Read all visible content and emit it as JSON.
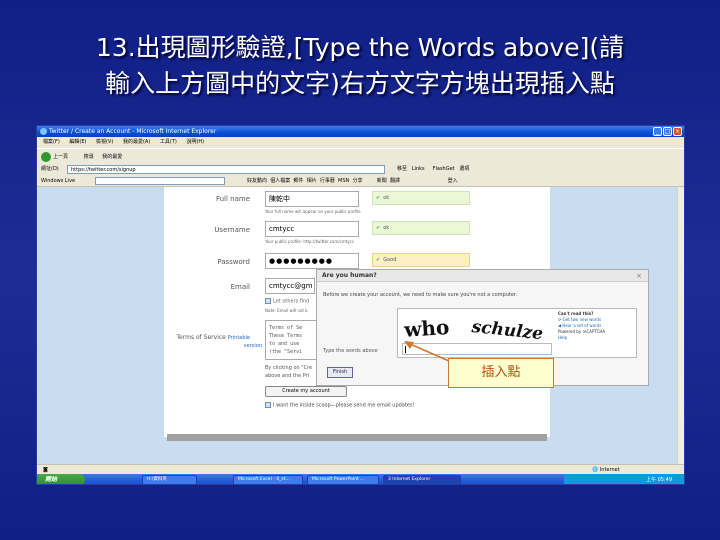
{
  "slide": {
    "title_line1": "13.出現圖形驗證,[Type the Words above](請",
    "title_line2": "輸入上方圖中的文字)右方文字方塊出現插入點"
  },
  "browser": {
    "title": "Twitter / Create an Account - Microsoft Internet Explorer",
    "menu": [
      "檔案(F)",
      "編輯(E)",
      "檢視(V)",
      "我的最愛(A)",
      "工具(T)",
      "說明(H)"
    ],
    "toolbar": {
      "back": "上一頁",
      "search": "搜尋",
      "favorites": "我的最愛"
    },
    "address": "https://twitter.com/signup",
    "go": "移至",
    "links": "Links",
    "flashget": "FlashGet",
    "options": "選項",
    "windows_live": "Windows Live",
    "live_links": [
      "好友動向",
      "個人檔案",
      "郵件",
      "相片",
      "行事曆",
      "MSN",
      "分享"
    ],
    "live_right": [
      "新聞",
      "翻譯"
    ],
    "login": "登入"
  },
  "form": {
    "full_name_label": "Full name",
    "full_name_value": "陳乾中",
    "full_name_hint": "Your full name will appear on your public profile",
    "username_label": "Username",
    "username_value": "cmtycc",
    "username_hint": "Your public profile: http://twitter.com/cmtycc",
    "password_label": "Password",
    "password_value": "●●●●●●●●●",
    "email_label": "Email",
    "email_value": "cmtycc@gm",
    "let_others": "Let others find",
    "email_note": "Note: Email will not b",
    "tos_label": "Terms of Service",
    "printable": "Printable",
    "version": "version",
    "tos_text_1": "Terms of Se",
    "tos_text_2": "These Terms",
    "tos_text_3": "to and use",
    "tos_text_4": "(the \"Servi",
    "agree_1": "By clicking on \"Cre",
    "agree_2": "above and the Pri",
    "create_button": "Create my account",
    "inside_scoop": "I want the inside scoop—please send me email updates!",
    "status_ok": "ok",
    "status_good": "Good"
  },
  "dialog": {
    "title": "Are you human?",
    "close": "×",
    "message": "Before we create your account, we need to make sure you're not a computer.",
    "words": [
      "who",
      "schulze"
    ],
    "input_label": "Type the words above",
    "cant_read": "Can't read this?",
    "new_words": "Get two new words",
    "hear": "Hear a set of words",
    "powered": "Powered by reCAPTCHA",
    "help": "Help",
    "finish": "Finish"
  },
  "callout": {
    "text": "插入點"
  },
  "statusbar": {
    "zone": "Internet"
  },
  "taskbar": {
    "start": "開始",
    "tasks": [
      "H:\\資料夾",
      "Microsoft Excel - 0_st...",
      "Microsoft PowerPoint ...",
      "3 Internet Explorer"
    ],
    "clock": "上午 05:49"
  },
  "colors": {
    "slide_bg": "#1a2a8c",
    "callout_border": "#d07a2a",
    "callout_text": "#c04a0a"
  }
}
